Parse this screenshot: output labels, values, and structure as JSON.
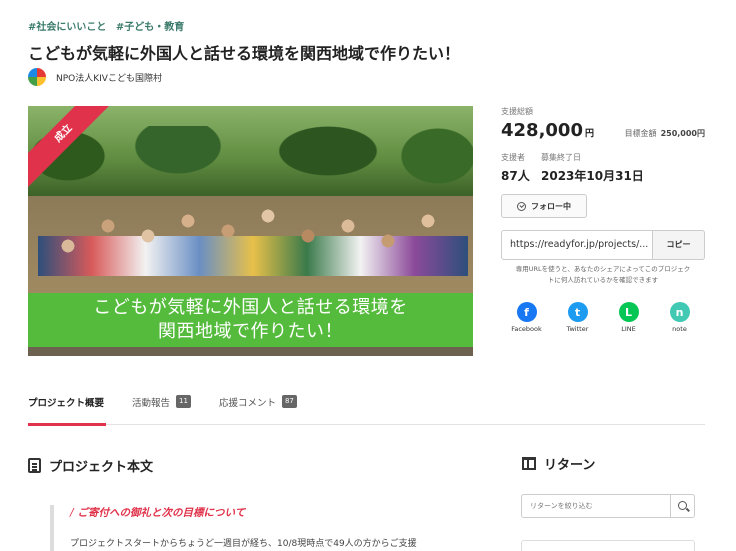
{
  "tags": [
    "#社会にいいこと",
    "#子ども・教育"
  ],
  "title": "こどもが気軽に外国人と話せる環境を関西地域で作りたい！",
  "owner": "NPO法人KIVこども国際村",
  "hero": {
    "ribbon": "成立",
    "banner_line1": "こどもが気軽に外国人と話せる環境を",
    "banner_line2": "関西地域で作りたい！"
  },
  "stats": {
    "total_label": "支援総額",
    "total_amount": "428,000",
    "currency": "円",
    "goal_label": "目標金額",
    "goal_amount": "250,000円",
    "supporters_label": "支援者",
    "supporters_value": "87人",
    "deadline_label": "募集終了日",
    "deadline_value": "2023年10月31日"
  },
  "follow_label": "フォロー中",
  "share": {
    "url": "https://readyfor.jp/projects/...",
    "copy_label": "コピー",
    "note": "専用URLを使うと、あなたのシェアによってこのプロジェクトに何人訪れているかを確認できます"
  },
  "social": [
    {
      "name": "Facebook",
      "icon": "f",
      "color": "#1877f2"
    },
    {
      "name": "Twitter",
      "icon": "t",
      "color": "#1d9bf0"
    },
    {
      "name": "LINE",
      "icon": "L",
      "color": "#06c755"
    },
    {
      "name": "note",
      "icon": "n",
      "color": "#41c9b4"
    }
  ],
  "tabs": [
    {
      "label": "プロジェクト概要",
      "count": ""
    },
    {
      "label": "活動報告",
      "count": "11"
    },
    {
      "label": "応援コメント",
      "count": "87"
    }
  ],
  "section": {
    "title": "プロジェクト本文",
    "quote_heading": "ご寄付への御礼と次の目標について",
    "quote_body": "プロジェクトスタートからちょうど一週目が経ち、10/8現時点で49人の方からご支援"
  },
  "returns": {
    "title": "リターン",
    "search_placeholder": "リターンを絞り込む"
  }
}
